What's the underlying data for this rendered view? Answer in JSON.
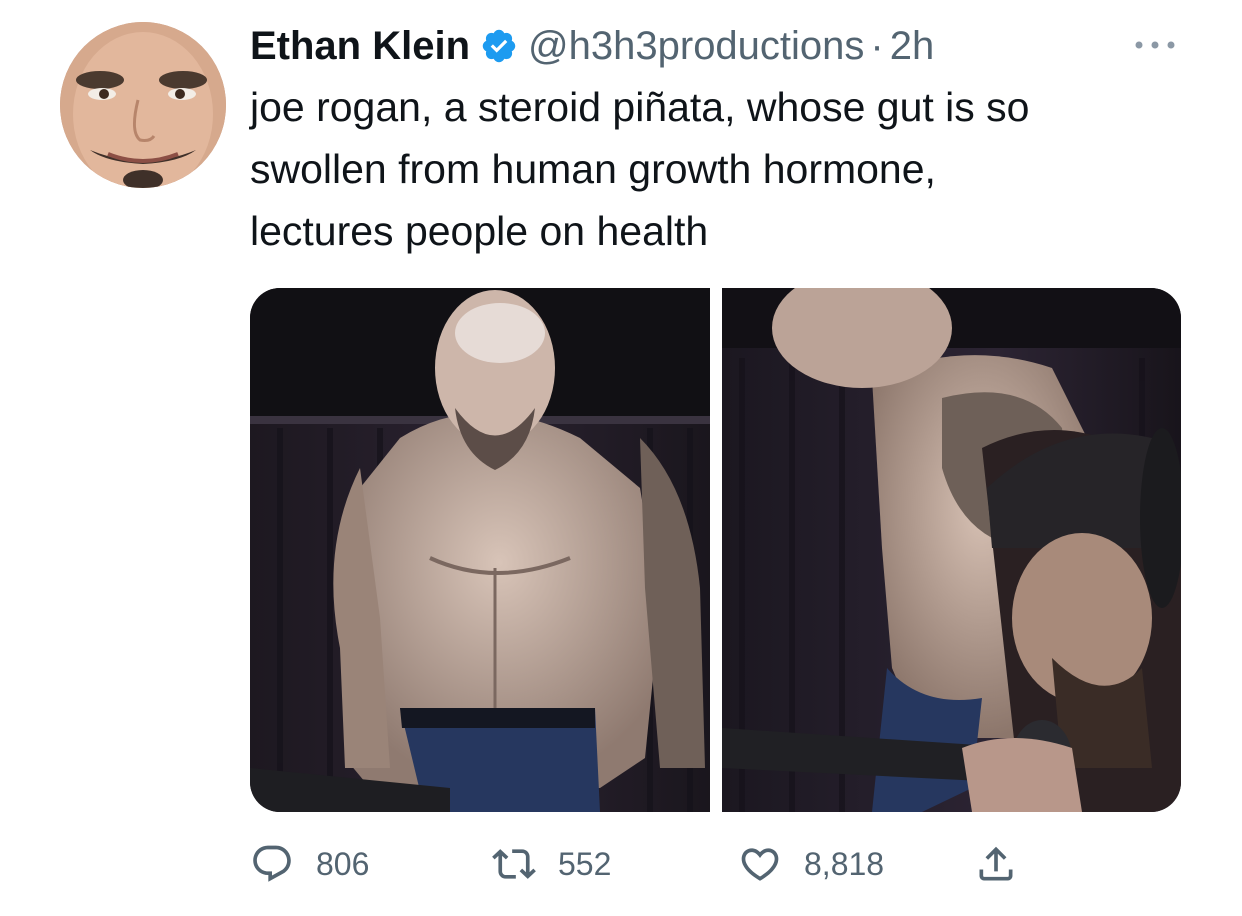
{
  "tweet": {
    "author": {
      "display_name": "Ethan Klein",
      "verified": true,
      "handle": "@h3h3productions",
      "avatar_icon": "profile-photo"
    },
    "separator": "·",
    "time": "2h",
    "more_icon": "more-horizontal-icon",
    "text_lines": [
      "joe rogan, a steroid piñata, whose gut is so",
      "swollen from human growth hormone,",
      "lectures people on health"
    ],
    "media": {
      "count": 2
    },
    "actions": {
      "reply": {
        "icon": "reply-icon",
        "count": "806"
      },
      "retweet": {
        "icon": "retweet-icon",
        "count": "552"
      },
      "like": {
        "icon": "heart-icon",
        "count": "8,818"
      },
      "share": {
        "icon": "share-icon"
      }
    }
  },
  "colors": {
    "text_primary": "#0f1419",
    "text_secondary": "#536471",
    "verified_blue": "#1d9bf0",
    "background": "#ffffff"
  }
}
